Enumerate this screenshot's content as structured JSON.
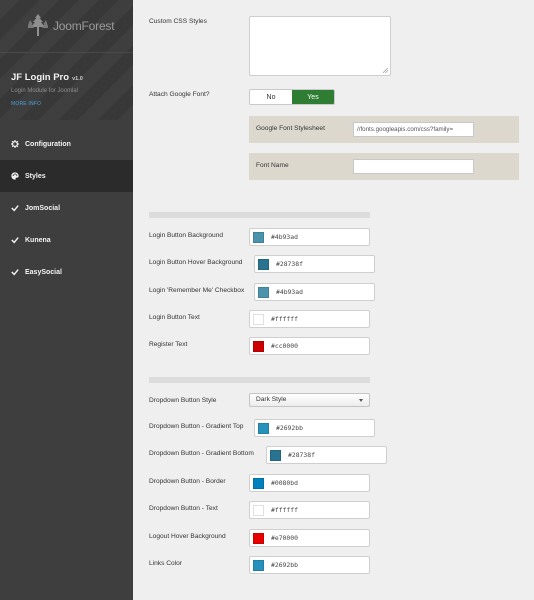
{
  "brand": {
    "logo_text": "JoomForest",
    "product_title": "JF Login Pro",
    "version": "v1.0",
    "subtitle": "Login Module for Joomla!",
    "more_info": "MORE INFO"
  },
  "nav": {
    "items": [
      {
        "label": "Configuration",
        "icon": "gear-icon"
      },
      {
        "label": "Styles",
        "icon": "palette-icon",
        "active": true
      },
      {
        "label": "JomSocial",
        "icon": "check-icon"
      },
      {
        "label": "Kunena",
        "icon": "check-icon"
      },
      {
        "label": "EasySocial",
        "icon": "check-icon"
      }
    ]
  },
  "form": {
    "custom_css_label": "Custom CSS Styles",
    "custom_css_value": "",
    "attach_font_label": "Attach Google Font?",
    "toggle_no": "No",
    "toggle_yes": "Yes",
    "toggle_selected": "Yes",
    "font_stylesheet_label": "Google Font Stylesheet",
    "font_stylesheet_value": "//fonts.googleapis.com/css?family=",
    "font_name_label": "Font Name",
    "font_name_value": ""
  },
  "colors_section_1": [
    {
      "label": "Login Button Background",
      "value": "#4b93ad",
      "swatch": "#4b93ad"
    },
    {
      "label": "Login Button Hover Background",
      "value": "#28738f",
      "swatch": "#28738f"
    },
    {
      "label": "Login 'Remember Me' Checkbox",
      "value": "#4b93ad",
      "swatch": "#4b93ad"
    },
    {
      "label": "Login Button Text",
      "value": "#ffffff",
      "swatch": "#ffffff"
    },
    {
      "label": "Register Text",
      "value": "#cc0000",
      "swatch": "#cc0000"
    }
  ],
  "dropdown": {
    "label": "Dropdown Button Style",
    "selected": "Dark Style"
  },
  "colors_section_2": [
    {
      "label": "Dropdown Button - Gradient Top",
      "value": "#2692bb",
      "swatch": "#2692bb"
    },
    {
      "label": "Dropdown Button - Gradient Bottom",
      "value": "#28738f",
      "swatch": "#28738f"
    },
    {
      "label": "Dropdown Button - Border",
      "value": "#0080bd",
      "swatch": "#0080bd"
    },
    {
      "label": "Dropdown Button - Text",
      "value": "#ffffff",
      "swatch": "#ffffff"
    },
    {
      "label": "Logout Hover Background",
      "value": "#e70000",
      "swatch": "#e70000"
    },
    {
      "label": "Links Color",
      "value": "#2692bb",
      "swatch": "#2692bb"
    }
  ],
  "theme": {
    "sidebar_bg": "#3e3e3e",
    "active_nav_bg": "#2b2b2b",
    "toggle_on": "#2f7d32",
    "sub_panel_bg": "#ddd8ce",
    "link_color": "#4aa3df"
  }
}
